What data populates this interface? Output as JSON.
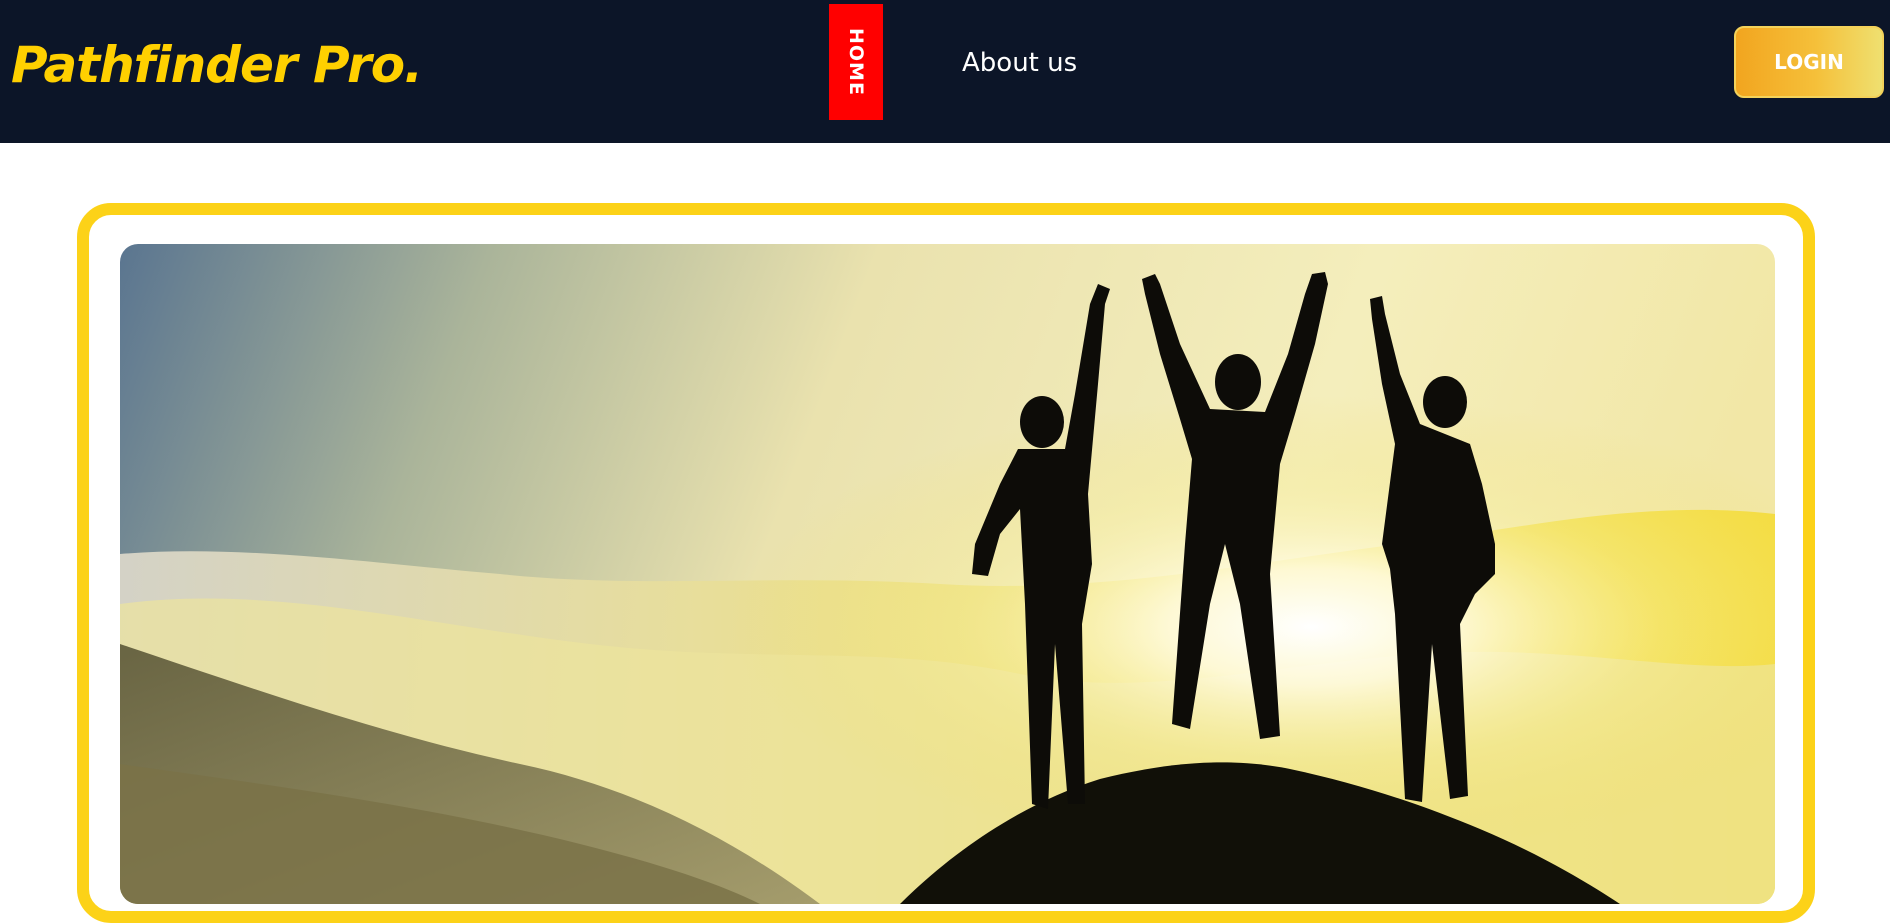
{
  "navbar": {
    "brand": "Pathfinder Pro.",
    "home_label": "HOME",
    "about_label": "About us",
    "login_label": "LOGIN"
  },
  "hero": {
    "image_icon": "mountain-summit-silhouettes-image"
  },
  "colors": {
    "navbar_bg": "#0c1528",
    "brand": "#ffd000",
    "home_active_bg": "#ff0000",
    "hero_border": "#fcd218",
    "login_gradient_start": "#f2a51f",
    "login_gradient_end": "#efe070"
  }
}
